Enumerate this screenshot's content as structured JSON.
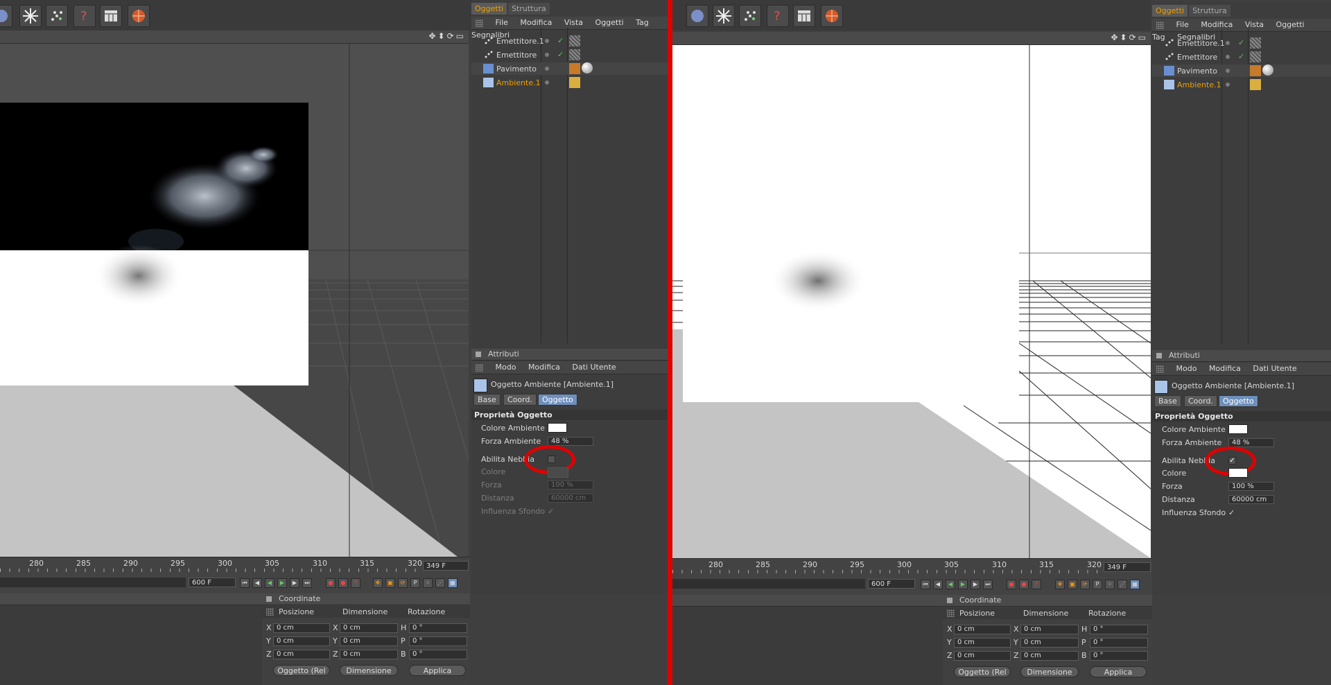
{
  "objects_panel": {
    "tabs": [
      "Oggetti",
      "Struttura"
    ],
    "menu": [
      "File",
      "Modifica",
      "Vista",
      "Oggetti",
      "Tag",
      "Segnalibri"
    ],
    "items": [
      "Emettitore.1",
      "Emettitore",
      "Pavimento",
      "Ambiente.1"
    ]
  },
  "attributes": {
    "title": "Attributi",
    "menu": [
      "Modo",
      "Modifica",
      "Dati Utente"
    ],
    "object_title": "Oggetto Ambiente [Ambiente.1]",
    "tabs": [
      "Base",
      "Coord.",
      "Oggetto"
    ],
    "section_title": "Proprietà Oggetto",
    "labels": {
      "colore_ambiente": "Colore Ambiente",
      "forza_ambiente": "Forza Ambiente",
      "abilita_nebbia": "Abilita Nebbia",
      "colore": "Colore",
      "forza": "Forza",
      "distanza": "Distanza",
      "influenza_sfondo": "Influenza Sfondo"
    },
    "left_values": {
      "forza_ambiente": "48 %",
      "forza": "100 %",
      "distanza": "60000 cm",
      "abilita_nebbia_check": "",
      "influenza_check": "✓"
    },
    "right_values": {
      "forza_ambiente": "48 %",
      "forza": "100 %",
      "distanza": "60000 cm",
      "abilita_nebbia_check": "✓",
      "influenza_check": "✓"
    }
  },
  "timeline": {
    "ticks": [
      "280",
      "285",
      "290",
      "295",
      "300",
      "305",
      "310",
      "315",
      "320"
    ],
    "current_frame": "349 F",
    "end_frame": "600 F"
  },
  "coordinates": {
    "title": "Coordinate",
    "headers": [
      "Posizione",
      "Dimensione",
      "Rotazione"
    ],
    "rows": [
      {
        "pos_axis": "X",
        "pos": "0 cm",
        "dim_axis": "X",
        "dim": "0 cm",
        "rot_axis": "H",
        "rot": "0 °"
      },
      {
        "pos_axis": "Y",
        "pos": "0 cm",
        "dim_axis": "Y",
        "dim": "0 cm",
        "rot_axis": "P",
        "rot": "0 °"
      },
      {
        "pos_axis": "Z",
        "pos": "0 cm",
        "dim_axis": "Z",
        "dim": "0 cm",
        "rot_axis": "B",
        "rot": "0 °"
      }
    ],
    "dropdown_object": "Oggetto (Rel",
    "dropdown_size": "Dimensione",
    "apply": "Applica"
  },
  "colors": {
    "accent": "#f0a000",
    "highlight": "#e00000",
    "selected_tab": "#6e8fbc"
  }
}
